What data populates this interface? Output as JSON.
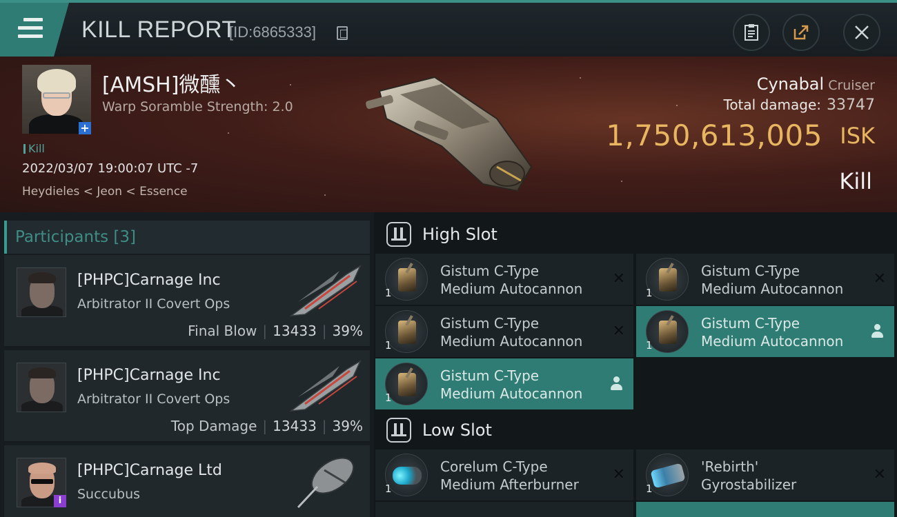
{
  "header": {
    "title": "KILL REPORT",
    "report_id": "[ID:6865333]",
    "icons": {
      "menu": "hamburger-menu-icon",
      "copy": "copy-icon",
      "clipboard": "clipboard-icon",
      "share": "share-icon",
      "close": "close-icon"
    }
  },
  "victim": {
    "name": "[AMSH]微醺丶",
    "warp_scramble": "Warp Soramble Strength: 2.0",
    "tag": "Kill",
    "datetime": "2022/03/07 19:00:07 UTC -7",
    "location": "Heydieles < Jeon < Essence",
    "ship_name": "Cynabal",
    "ship_class": "Cruiser",
    "total_damage_label": "Total damage:",
    "total_damage": "33747",
    "isk_value": "1,750,613,005",
    "isk_unit": "ISK",
    "result": "Kill"
  },
  "participants": {
    "label": "Participants",
    "count": "[3]",
    "items": [
      {
        "name": "[PHPC]Carnage Inc",
        "ship": "Arbitrator II Covert Ops",
        "role": "Final Blow",
        "damage": "13433",
        "percent": "39%"
      },
      {
        "name": "[PHPC]Carnage Inc",
        "ship": "Arbitrator II Covert Ops",
        "role": "Top Damage",
        "damage": "13433",
        "percent": "39%"
      },
      {
        "name": "[PHPC]Carnage Ltd",
        "ship": "Succubus",
        "role": "",
        "damage": "",
        "percent": ""
      }
    ]
  },
  "fitting": {
    "high_slot": {
      "title": "High Slot",
      "modules": [
        {
          "qty": "1",
          "line1": "Gistum C-Type",
          "line2": "Medium Autocannon",
          "status": "destroyed"
        },
        {
          "qty": "1",
          "line1": "Gistum C-Type",
          "line2": "Medium Autocannon",
          "status": "destroyed"
        },
        {
          "qty": "1",
          "line1": "Gistum C-Type",
          "line2": "Medium Autocannon",
          "status": "destroyed"
        },
        {
          "qty": "1",
          "line1": "Gistum C-Type",
          "line2": "Medium Autocannon",
          "status": "dropped"
        },
        {
          "qty": "1",
          "line1": "Gistum C-Type",
          "line2": "Medium Autocannon",
          "status": "dropped"
        }
      ]
    },
    "low_slot": {
      "title": "Low Slot",
      "modules": [
        {
          "qty": "1",
          "line1": "Corelum C-Type",
          "line2": "Medium Afterburner",
          "status": "destroyed"
        },
        {
          "qty": "1",
          "line1": "'Rebirth'",
          "line2": "Gyrostabilizer",
          "status": "destroyed"
        }
      ]
    }
  },
  "colors": {
    "accent": "#2f7c74",
    "isk": "#e8b661",
    "panel": "#20282c"
  }
}
